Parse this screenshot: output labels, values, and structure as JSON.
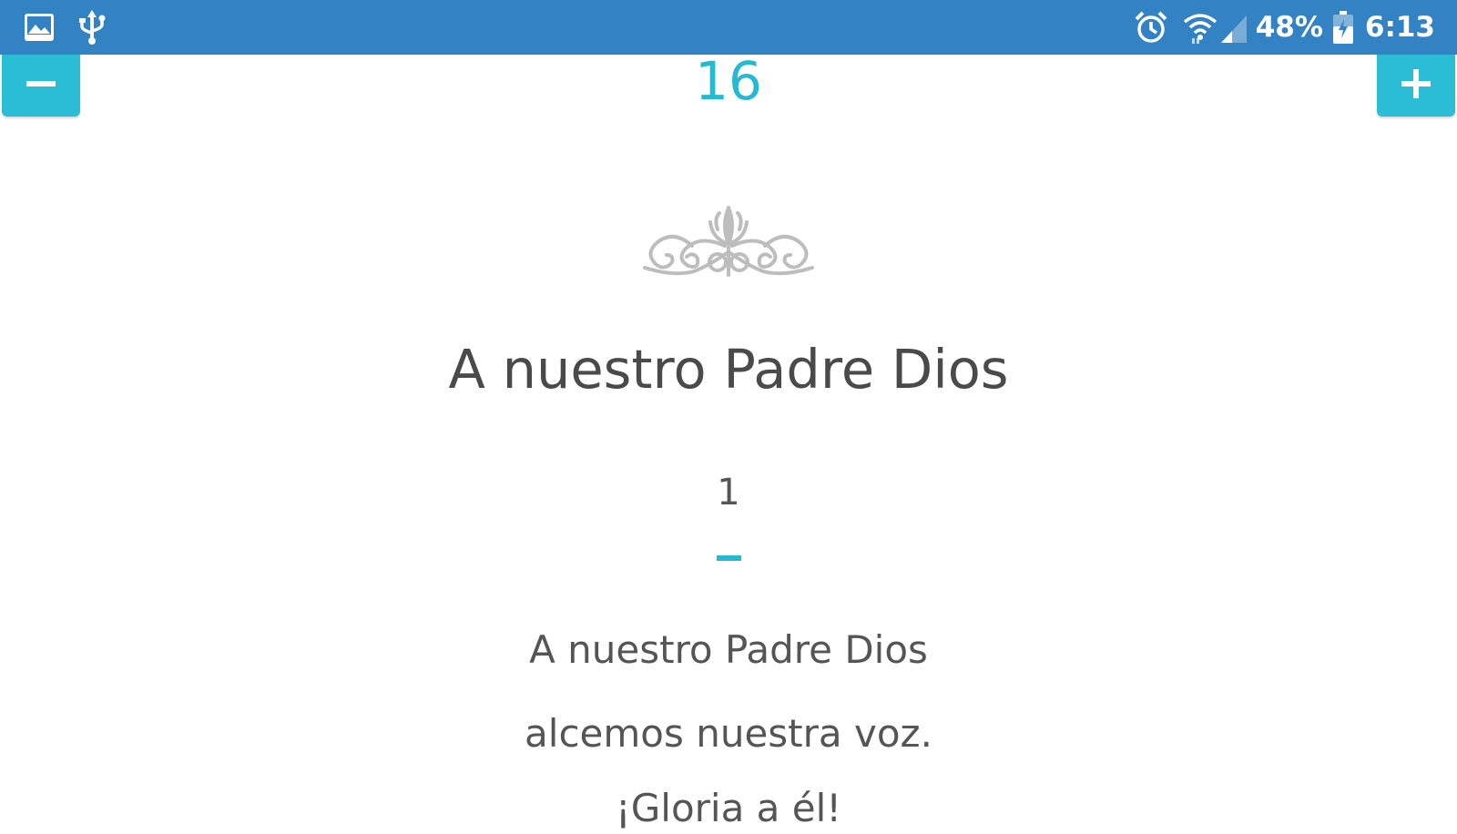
{
  "status_bar": {
    "left_icons": [
      "image-icon",
      "usb-icon"
    ],
    "right_icons": [
      "alarm-icon",
      "wifi-icon",
      "signal-icon",
      "battery-icon"
    ],
    "battery_percent": "48%",
    "time": "6:13",
    "background_color": "#3282c4"
  },
  "controls": {
    "decrease_icon": "minus-icon",
    "increase_icon": "plus-icon",
    "font_size": "16",
    "accent_color": "#2bbcd6"
  },
  "song": {
    "ornament_icon": "flourish-ornament-icon",
    "title": "A nuestro Padre Dios",
    "verse_number": "1",
    "lines": [
      "A nuestro Padre Dios",
      "alcemos nuestra voz.",
      "¡Gloria a él!"
    ]
  }
}
